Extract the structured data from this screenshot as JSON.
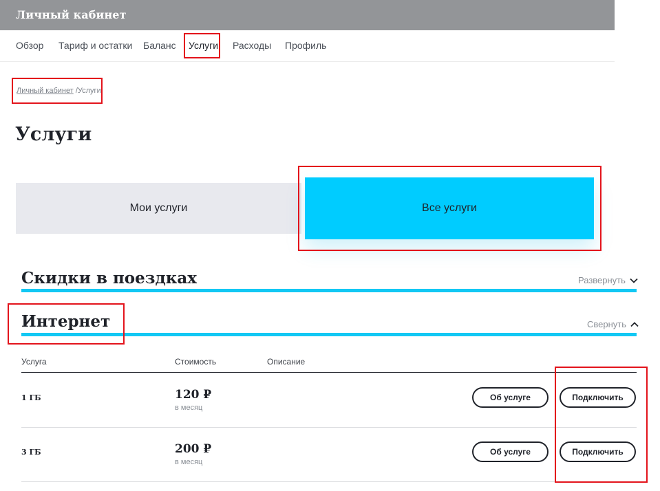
{
  "header": {
    "title": "Личный кабинет"
  },
  "nav": {
    "items": [
      {
        "label": "Обзор"
      },
      {
        "label": "Тариф и остатки"
      },
      {
        "label": "Баланс"
      },
      {
        "label": "Услуги"
      },
      {
        "label": "Расходы"
      },
      {
        "label": "Профиль"
      }
    ],
    "active_index": 3
  },
  "breadcrumb": {
    "root": "Личный кабинет",
    "separator": "/",
    "current": "Услуги"
  },
  "page": {
    "title": "Услуги"
  },
  "tabs": [
    {
      "label": "Мои услуги",
      "active": false
    },
    {
      "label": "Все услуги",
      "active": true
    }
  ],
  "sections": [
    {
      "title": "Скидки в поездках",
      "toggle_label": "Развернуть",
      "toggle_icon": "chevron-down-icon"
    },
    {
      "title": "Интернет",
      "toggle_label": "Свернуть",
      "toggle_icon": "chevron-up-icon"
    }
  ],
  "table": {
    "columns": [
      "Услуга",
      "Стоимость",
      "Описание"
    ],
    "rows": [
      {
        "name": "1 ГБ",
        "price": "120 ₽",
        "unit": "в месяц",
        "info_label": "Об услуге",
        "connect_label": "Подключить"
      },
      {
        "name": "3 ГБ",
        "price": "200 ₽",
        "unit": "в месяц",
        "info_label": "Об услуге",
        "connect_label": "Подключить"
      }
    ]
  },
  "colors": {
    "accent": "#00ccff",
    "section_line": "#12c8f4",
    "header_bg": "#939598",
    "highlight": "#e3131b"
  }
}
